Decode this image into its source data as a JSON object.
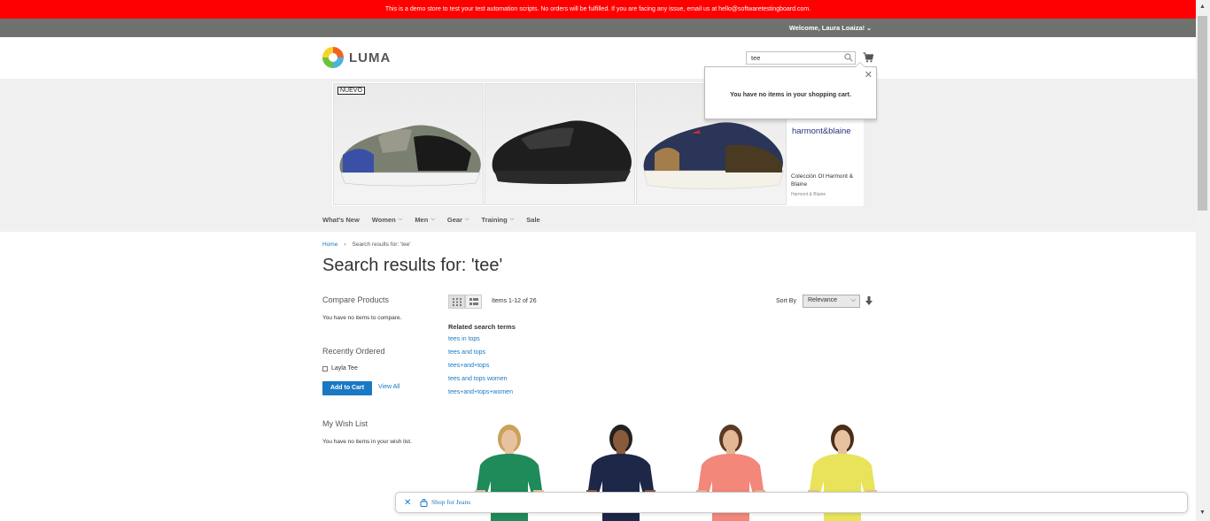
{
  "demo_notice": "This is a demo store to test your test automation scripts. No orders will be fulfilled. If you are facing any issue, email us at hello@softwaretestingboard.com.",
  "header": {
    "welcome": "Welcome, Laura Loaiza!",
    "logo_text": "LUMA",
    "search_value": "tee"
  },
  "minicart": {
    "message": "You have no items in your shopping cart."
  },
  "banner": {
    "badge": "NUEVO",
    "brand": "harmont&blaine",
    "collection": "Colección OI Harmont & Blaine",
    "brand_small": "Harmont & Blaine"
  },
  "nav": {
    "items": [
      {
        "label": "What's New",
        "has_menu": false
      },
      {
        "label": "Women",
        "has_menu": true
      },
      {
        "label": "Men",
        "has_menu": true
      },
      {
        "label": "Gear",
        "has_menu": true
      },
      {
        "label": "Training",
        "has_menu": true
      },
      {
        "label": "Sale",
        "has_menu": false
      }
    ]
  },
  "breadcrumb": {
    "home": "Home",
    "separator": "›",
    "current": "Search results for: 'tee'"
  },
  "page_title": "Search results for: 'tee'",
  "sidebar": {
    "compare_title": "Compare Products",
    "compare_empty": "You have no items to compare.",
    "recent_title": "Recently Ordered",
    "recent_item": "Layla Tee",
    "add_to_cart": "Add to Cart",
    "view_all": "View All",
    "wishlist_title": "My Wish List",
    "wishlist_empty": "You have no items in your wish list."
  },
  "toolbar": {
    "amount": "Items 1-12 of 26",
    "sort_label": "Sort By",
    "sort_value": "Relevance"
  },
  "related": {
    "title": "Related search terms",
    "terms": [
      "tees in tops",
      "tees and tops",
      "tees+and+tops",
      "tees and tops women",
      "tees+and+tops+women"
    ]
  },
  "products": [
    {
      "shirt_color": "#1f8a5a",
      "skin": "#e8c2a0",
      "hair": "#c9a25a"
    },
    {
      "shirt_color": "#1d2747",
      "skin": "#8a5a3c",
      "hair": "#222222"
    },
    {
      "shirt_color": "#f2877a",
      "skin": "#e3b694",
      "hair": "#5a3a22"
    },
    {
      "shirt_color": "#e8e35a",
      "skin": "#e8c2a0",
      "hair": "#4a2e1a"
    }
  ],
  "jeans_bar": {
    "label": "Shop for Jeans"
  },
  "colors": {
    "demo_bar": "#ff0000",
    "accent": "#1979c3"
  }
}
